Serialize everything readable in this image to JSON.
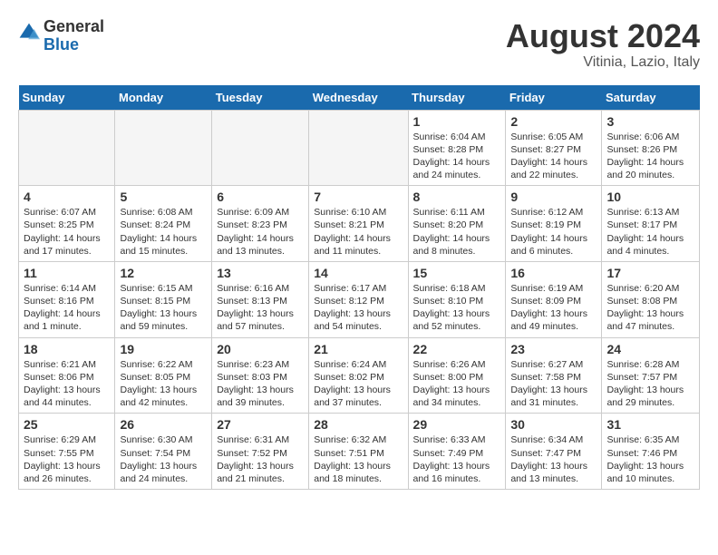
{
  "logo": {
    "general": "General",
    "blue": "Blue"
  },
  "title": "August 2024",
  "location": "Vitinia, Lazio, Italy",
  "weekdays": [
    "Sunday",
    "Monday",
    "Tuesday",
    "Wednesday",
    "Thursday",
    "Friday",
    "Saturday"
  ],
  "weeks": [
    [
      {
        "day": "",
        "info": ""
      },
      {
        "day": "",
        "info": ""
      },
      {
        "day": "",
        "info": ""
      },
      {
        "day": "",
        "info": ""
      },
      {
        "day": "1",
        "info": "Sunrise: 6:04 AM\nSunset: 8:28 PM\nDaylight: 14 hours\nand 24 minutes."
      },
      {
        "day": "2",
        "info": "Sunrise: 6:05 AM\nSunset: 8:27 PM\nDaylight: 14 hours\nand 22 minutes."
      },
      {
        "day": "3",
        "info": "Sunrise: 6:06 AM\nSunset: 8:26 PM\nDaylight: 14 hours\nand 20 minutes."
      }
    ],
    [
      {
        "day": "4",
        "info": "Sunrise: 6:07 AM\nSunset: 8:25 PM\nDaylight: 14 hours\nand 17 minutes."
      },
      {
        "day": "5",
        "info": "Sunrise: 6:08 AM\nSunset: 8:24 PM\nDaylight: 14 hours\nand 15 minutes."
      },
      {
        "day": "6",
        "info": "Sunrise: 6:09 AM\nSunset: 8:23 PM\nDaylight: 14 hours\nand 13 minutes."
      },
      {
        "day": "7",
        "info": "Sunrise: 6:10 AM\nSunset: 8:21 PM\nDaylight: 14 hours\nand 11 minutes."
      },
      {
        "day": "8",
        "info": "Sunrise: 6:11 AM\nSunset: 8:20 PM\nDaylight: 14 hours\nand 8 minutes."
      },
      {
        "day": "9",
        "info": "Sunrise: 6:12 AM\nSunset: 8:19 PM\nDaylight: 14 hours\nand 6 minutes."
      },
      {
        "day": "10",
        "info": "Sunrise: 6:13 AM\nSunset: 8:17 PM\nDaylight: 14 hours\nand 4 minutes."
      }
    ],
    [
      {
        "day": "11",
        "info": "Sunrise: 6:14 AM\nSunset: 8:16 PM\nDaylight: 14 hours\nand 1 minute."
      },
      {
        "day": "12",
        "info": "Sunrise: 6:15 AM\nSunset: 8:15 PM\nDaylight: 13 hours\nand 59 minutes."
      },
      {
        "day": "13",
        "info": "Sunrise: 6:16 AM\nSunset: 8:13 PM\nDaylight: 13 hours\nand 57 minutes."
      },
      {
        "day": "14",
        "info": "Sunrise: 6:17 AM\nSunset: 8:12 PM\nDaylight: 13 hours\nand 54 minutes."
      },
      {
        "day": "15",
        "info": "Sunrise: 6:18 AM\nSunset: 8:10 PM\nDaylight: 13 hours\nand 52 minutes."
      },
      {
        "day": "16",
        "info": "Sunrise: 6:19 AM\nSunset: 8:09 PM\nDaylight: 13 hours\nand 49 minutes."
      },
      {
        "day": "17",
        "info": "Sunrise: 6:20 AM\nSunset: 8:08 PM\nDaylight: 13 hours\nand 47 minutes."
      }
    ],
    [
      {
        "day": "18",
        "info": "Sunrise: 6:21 AM\nSunset: 8:06 PM\nDaylight: 13 hours\nand 44 minutes."
      },
      {
        "day": "19",
        "info": "Sunrise: 6:22 AM\nSunset: 8:05 PM\nDaylight: 13 hours\nand 42 minutes."
      },
      {
        "day": "20",
        "info": "Sunrise: 6:23 AM\nSunset: 8:03 PM\nDaylight: 13 hours\nand 39 minutes."
      },
      {
        "day": "21",
        "info": "Sunrise: 6:24 AM\nSunset: 8:02 PM\nDaylight: 13 hours\nand 37 minutes."
      },
      {
        "day": "22",
        "info": "Sunrise: 6:26 AM\nSunset: 8:00 PM\nDaylight: 13 hours\nand 34 minutes."
      },
      {
        "day": "23",
        "info": "Sunrise: 6:27 AM\nSunset: 7:58 PM\nDaylight: 13 hours\nand 31 minutes."
      },
      {
        "day": "24",
        "info": "Sunrise: 6:28 AM\nSunset: 7:57 PM\nDaylight: 13 hours\nand 29 minutes."
      }
    ],
    [
      {
        "day": "25",
        "info": "Sunrise: 6:29 AM\nSunset: 7:55 PM\nDaylight: 13 hours\nand 26 minutes."
      },
      {
        "day": "26",
        "info": "Sunrise: 6:30 AM\nSunset: 7:54 PM\nDaylight: 13 hours\nand 24 minutes."
      },
      {
        "day": "27",
        "info": "Sunrise: 6:31 AM\nSunset: 7:52 PM\nDaylight: 13 hours\nand 21 minutes."
      },
      {
        "day": "28",
        "info": "Sunrise: 6:32 AM\nSunset: 7:51 PM\nDaylight: 13 hours\nand 18 minutes."
      },
      {
        "day": "29",
        "info": "Sunrise: 6:33 AM\nSunset: 7:49 PM\nDaylight: 13 hours\nand 16 minutes."
      },
      {
        "day": "30",
        "info": "Sunrise: 6:34 AM\nSunset: 7:47 PM\nDaylight: 13 hours\nand 13 minutes."
      },
      {
        "day": "31",
        "info": "Sunrise: 6:35 AM\nSunset: 7:46 PM\nDaylight: 13 hours\nand 10 minutes."
      }
    ]
  ]
}
